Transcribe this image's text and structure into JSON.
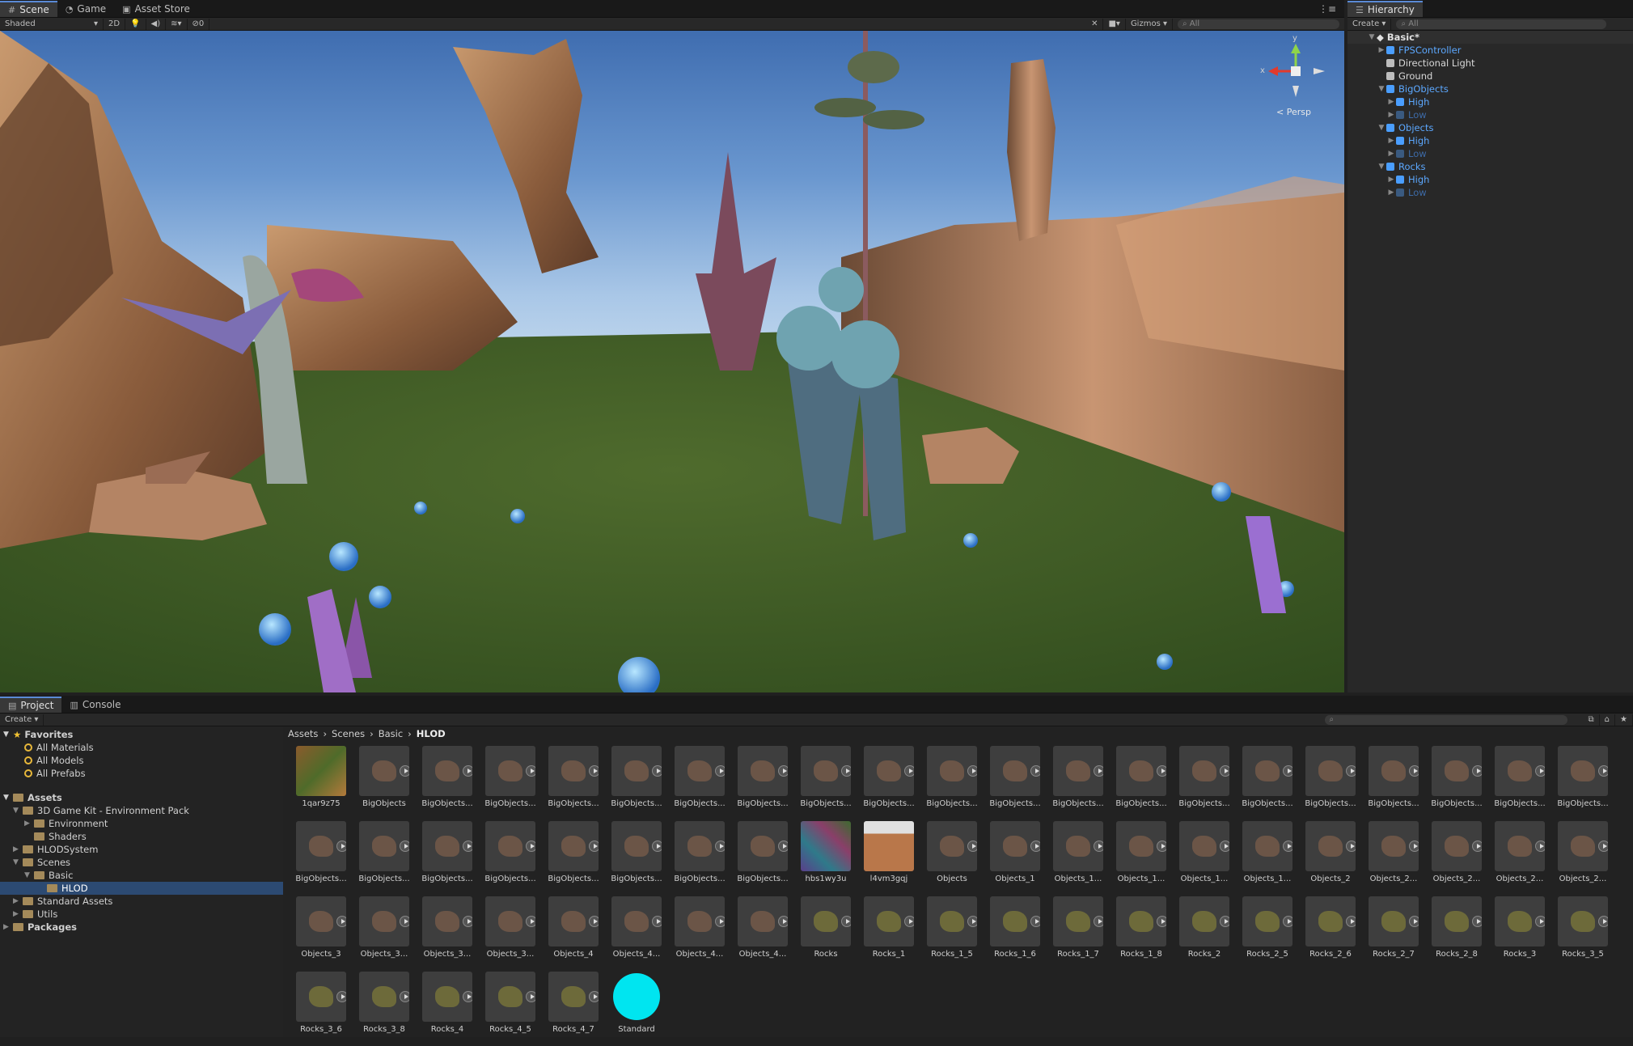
{
  "scene_tabs": [
    {
      "label": "Scene",
      "icon": "grid-icon"
    },
    {
      "label": "Game",
      "icon": "pacman-icon"
    },
    {
      "label": "Asset Store",
      "icon": "bag-icon"
    }
  ],
  "scene_toolbar": {
    "shading": "Shaded",
    "mode_2d": "2D",
    "hidden_count": "0",
    "gizmos": "Gizmos",
    "search_placeholder": "All"
  },
  "viewport": {
    "persp_label": "< Persp",
    "axis_y": "y",
    "axis_x": "x"
  },
  "hierarchy": {
    "title": "Hierarchy",
    "create": "Create",
    "search_placeholder": "All",
    "scene": "Basic*",
    "items": [
      {
        "label": "FPSController",
        "kind": "prefab"
      },
      {
        "label": "Directional Light",
        "kind": "object"
      },
      {
        "label": "Ground",
        "kind": "object"
      },
      {
        "label": "BigObjects",
        "kind": "prefab"
      },
      {
        "label": "High",
        "kind": "prefab"
      },
      {
        "label": "Low",
        "kind": "disabled"
      },
      {
        "label": "Objects",
        "kind": "prefab"
      },
      {
        "label": "High",
        "kind": "prefab"
      },
      {
        "label": "Low",
        "kind": "disabled"
      },
      {
        "label": "Rocks",
        "kind": "prefab"
      },
      {
        "label": "High",
        "kind": "prefab"
      },
      {
        "label": "Low",
        "kind": "disabled"
      }
    ]
  },
  "project": {
    "tabs": [
      "Project",
      "Console"
    ],
    "create": "Create",
    "breadcrumb": [
      "Assets",
      "Scenes",
      "Basic",
      "HLOD"
    ],
    "favorites_title": "Favorites",
    "favorites": [
      "All Materials",
      "All Models",
      "All Prefabs"
    ],
    "assets_title": "Assets",
    "tree": [
      "3D Game Kit - Environment Pack",
      "Environment",
      "Shaders",
      "HLODSystem",
      "Scenes",
      "Basic",
      "HLOD",
      "Standard Assets",
      "Utils"
    ],
    "packages_title": "Packages",
    "assets": [
      {
        "label": "1qar9z75",
        "type": "tex"
      },
      {
        "label": "BigObjects",
        "type": "mesh"
      },
      {
        "label": "BigObjects...",
        "type": "mesh"
      },
      {
        "label": "BigObjects...",
        "type": "mesh"
      },
      {
        "label": "BigObjects...",
        "type": "mesh"
      },
      {
        "label": "BigObjects...",
        "type": "mesh"
      },
      {
        "label": "BigObjects...",
        "type": "mesh"
      },
      {
        "label": "BigObjects...",
        "type": "mesh"
      },
      {
        "label": "BigObjects...",
        "type": "mesh"
      },
      {
        "label": "BigObjects...",
        "type": "mesh"
      },
      {
        "label": "BigObjects...",
        "type": "mesh"
      },
      {
        "label": "BigObjects...",
        "type": "mesh"
      },
      {
        "label": "BigObjects...",
        "type": "mesh"
      },
      {
        "label": "BigObjects...",
        "type": "mesh"
      },
      {
        "label": "BigObjects...",
        "type": "mesh"
      },
      {
        "label": "BigObjects...",
        "type": "mesh"
      },
      {
        "label": "BigObjects...",
        "type": "mesh"
      },
      {
        "label": "BigObjects...",
        "type": "mesh"
      },
      {
        "label": "BigObjects...",
        "type": "mesh"
      },
      {
        "label": "BigObjects...",
        "type": "mesh"
      },
      {
        "label": "BigObjects...",
        "type": "mesh"
      },
      {
        "label": "BigObjects...",
        "type": "mesh"
      },
      {
        "label": "BigObjects...",
        "type": "mesh"
      },
      {
        "label": "BigObjects...",
        "type": "mesh"
      },
      {
        "label": "BigObjects...",
        "type": "mesh"
      },
      {
        "label": "BigObjects...",
        "type": "mesh"
      },
      {
        "label": "BigObjects...",
        "type": "mesh"
      },
      {
        "label": "BigObjects...",
        "type": "mesh"
      },
      {
        "label": "BigObjects...",
        "type": "mesh"
      },
      {
        "label": "hbs1wy3u",
        "type": "tex2"
      },
      {
        "label": "l4vm3gqj",
        "type": "tex3"
      },
      {
        "label": "Objects",
        "type": "mesh"
      },
      {
        "label": "Objects_1",
        "type": "mesh"
      },
      {
        "label": "Objects_1...",
        "type": "mesh"
      },
      {
        "label": "Objects_1...",
        "type": "mesh"
      },
      {
        "label": "Objects_1...",
        "type": "mesh"
      },
      {
        "label": "Objects_1...",
        "type": "mesh"
      },
      {
        "label": "Objects_2",
        "type": "mesh"
      },
      {
        "label": "Objects_2...",
        "type": "mesh"
      },
      {
        "label": "Objects_2...",
        "type": "mesh"
      },
      {
        "label": "Objects_2...",
        "type": "mesh"
      },
      {
        "label": "Objects_2...",
        "type": "mesh"
      },
      {
        "label": "Objects_3",
        "type": "mesh"
      },
      {
        "label": "Objects_3...",
        "type": "mesh"
      },
      {
        "label": "Objects_3...",
        "type": "mesh"
      },
      {
        "label": "Objects_3...",
        "type": "mesh"
      },
      {
        "label": "Objects_4",
        "type": "mesh"
      },
      {
        "label": "Objects_4...",
        "type": "mesh"
      },
      {
        "label": "Objects_4...",
        "type": "mesh"
      },
      {
        "label": "Objects_4...",
        "type": "mesh"
      },
      {
        "label": "Rocks",
        "type": "mesh"
      },
      {
        "label": "Rocks_1",
        "type": "mesh"
      },
      {
        "label": "Rocks_1_5",
        "type": "mesh"
      },
      {
        "label": "Rocks_1_6",
        "type": "mesh"
      },
      {
        "label": "Rocks_1_7",
        "type": "mesh"
      },
      {
        "label": "Rocks_1_8",
        "type": "mesh"
      },
      {
        "label": "Rocks_2",
        "type": "mesh"
      },
      {
        "label": "Rocks_2_5",
        "type": "mesh"
      },
      {
        "label": "Rocks_2_6",
        "type": "mesh"
      },
      {
        "label": "Rocks_2_7",
        "type": "mesh"
      },
      {
        "label": "Rocks_2_8",
        "type": "mesh"
      },
      {
        "label": "Rocks_3",
        "type": "mesh"
      },
      {
        "label": "Rocks_3_5",
        "type": "mesh"
      },
      {
        "label": "Rocks_3_6",
        "type": "mesh"
      },
      {
        "label": "Rocks_3_8",
        "type": "mesh"
      },
      {
        "label": "Rocks_4",
        "type": "mesh"
      },
      {
        "label": "Rocks_4_5",
        "type": "mesh"
      },
      {
        "label": "Rocks_4_7",
        "type": "mesh"
      },
      {
        "label": "Standard",
        "type": "material"
      }
    ]
  },
  "colors": {
    "accent": "#5a8ad5",
    "prefab": "#4a9eff",
    "material": "#00e5f0"
  }
}
